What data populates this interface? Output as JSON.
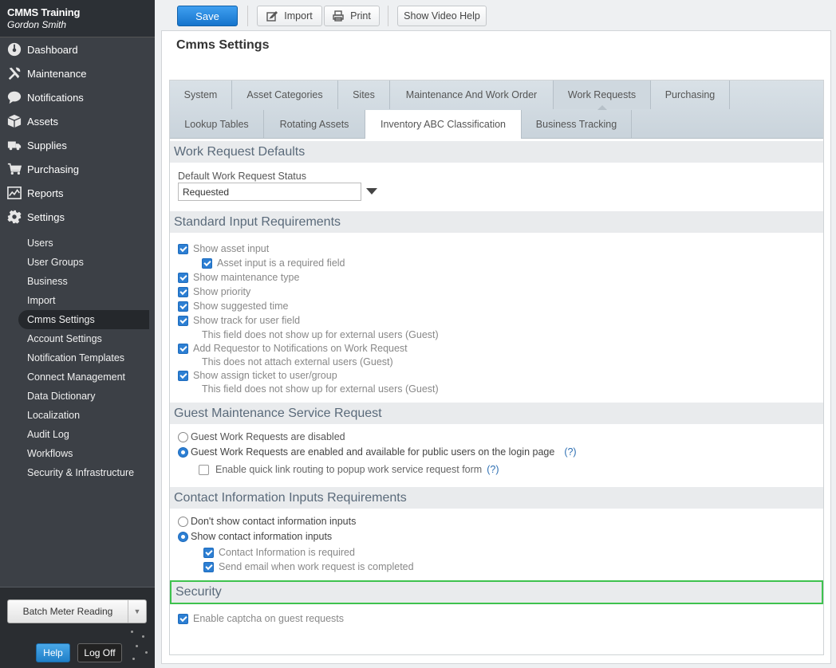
{
  "app": {
    "name": "CMMS Training",
    "user": "Gordon Smith"
  },
  "nav": [
    {
      "label": "Dashboard",
      "icon": "dashboard-icon"
    },
    {
      "label": "Maintenance",
      "icon": "tools-icon"
    },
    {
      "label": "Notifications",
      "icon": "chat-bubble-icon"
    },
    {
      "label": "Assets",
      "icon": "boxes-icon"
    },
    {
      "label": "Supplies",
      "icon": "truck-icon"
    },
    {
      "label": "Purchasing",
      "icon": "cart-icon"
    },
    {
      "label": "Reports",
      "icon": "chart-icon"
    },
    {
      "label": "Settings",
      "icon": "gear-icon"
    }
  ],
  "settings_nav": [
    "Users",
    "User Groups",
    "Business",
    "Import",
    "Cmms Settings",
    "Account Settings",
    "Notification Templates",
    "Connect Management",
    "Data Dictionary",
    "Localization",
    "Audit Log",
    "Workflows",
    "Security & Infrastructure"
  ],
  "active_settings_item": "Cmms Settings",
  "bottom": {
    "batch_label": "Batch Meter Reading",
    "help_label": "Help",
    "logoff_label": "Log Off"
  },
  "toolbar": {
    "save": "Save",
    "import": "Import",
    "print": "Print",
    "video": "Show Video Help"
  },
  "page_title": "Cmms Settings",
  "tabs_row1": [
    "System",
    "Asset Categories",
    "Sites",
    "Maintenance And Work Order",
    "Work Requests",
    "Purchasing"
  ],
  "tabs_row2": [
    "Lookup Tables",
    "Rotating Assets",
    "Inventory ABC Classification",
    "Business Tracking"
  ],
  "sections": {
    "defaults": {
      "title": "Work Request Defaults",
      "status_label": "Default Work Request Status",
      "status_value": "Requested"
    },
    "standard": {
      "title": "Standard Input Requirements",
      "items": {
        "show_asset": "Show asset input",
        "asset_required": "Asset input is a required field",
        "show_maint_type": "Show maintenance type",
        "show_priority": "Show priority",
        "show_suggested_time": "Show suggested time",
        "show_track": "Show track for user field",
        "track_note": "This field does not show up for external users (Guest)",
        "add_requestor": "Add Requestor to Notifications on Work Request",
        "requestor_note": "This does not attach external users (Guest)",
        "show_assign": "Show assign ticket to user/group",
        "assign_note": "This field does not show up for external users (Guest)"
      }
    },
    "guest": {
      "title": "Guest Maintenance Service Request",
      "disabled": "Guest Work Requests are disabled",
      "enabled": "Guest Work Requests are enabled and available for public users on the login page",
      "quick_link": "Enable quick link routing to popup work service request form",
      "help_mark": "(?)"
    },
    "contact": {
      "title": "Contact Information Inputs Requirements",
      "dont_show": "Don't show contact information inputs",
      "show": "Show contact information inputs",
      "required": "Contact Information is required",
      "send_email": "Send email when work request is completed"
    },
    "security": {
      "title": "Security",
      "captcha": "Enable captcha on guest requests"
    }
  },
  "colors": {
    "accent": "#2d7fd3",
    "highlight": "#3ec24e",
    "sidebar": "#3c4046"
  }
}
